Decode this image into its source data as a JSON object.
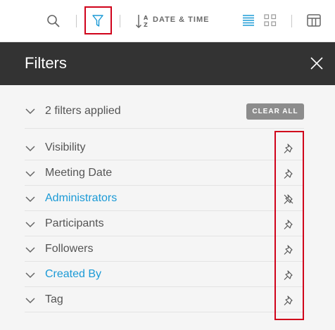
{
  "toolbar": {
    "sort_label": "DATE & TIME",
    "icons": [
      "search-icon",
      "filter-icon",
      "sort-az-icon",
      "list-view-icon",
      "grid-view-icon",
      "columns-icon"
    ],
    "active_color": "#1b9ad6"
  },
  "panel": {
    "title": "Filters",
    "summary": "2 filters applied",
    "clear_all_label": "CLEAR ALL",
    "header_bg": "#333333",
    "highlight_color": "#d0021b"
  },
  "filters": [
    {
      "label": "Visibility",
      "active": false,
      "pinned": true
    },
    {
      "label": "Meeting Date",
      "active": false,
      "pinned": true
    },
    {
      "label": "Administrators",
      "active": true,
      "pinned": false
    },
    {
      "label": "Participants",
      "active": false,
      "pinned": true
    },
    {
      "label": "Followers",
      "active": false,
      "pinned": true
    },
    {
      "label": "Created By",
      "active": true,
      "pinned": true
    },
    {
      "label": "Tag",
      "active": false,
      "pinned": true
    }
  ]
}
